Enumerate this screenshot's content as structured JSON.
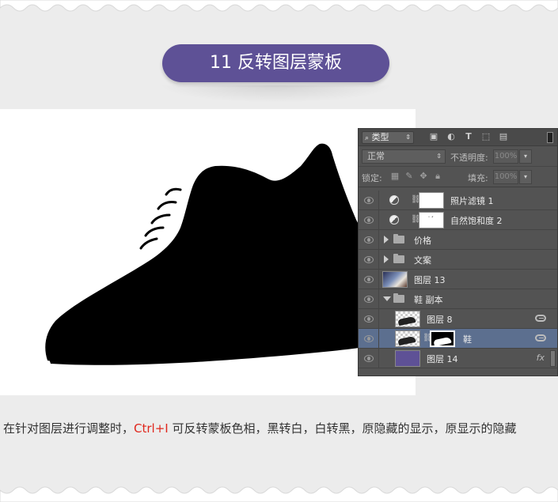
{
  "title": "11 反转图层蒙板",
  "panel": {
    "filter_label": "类型",
    "blend_mode": "正常",
    "opacity_label": "不透明度:",
    "opacity_value": "100%",
    "lock_label": "锁定:",
    "fill_label": "填充:",
    "fill_value": "100%",
    "layers": [
      {
        "name": "照片滤镜 1",
        "kind": "adjustment"
      },
      {
        "name": "自然饱和度 2",
        "kind": "adjustment"
      },
      {
        "name": "价格",
        "kind": "group-collapsed"
      },
      {
        "name": "文案",
        "kind": "group-collapsed"
      },
      {
        "name": "图层 13",
        "kind": "image"
      },
      {
        "name": "鞋 副本",
        "kind": "group-expanded"
      },
      {
        "name": "图层 8",
        "kind": "image-linked"
      },
      {
        "name": "鞋",
        "kind": "image-masked",
        "selected": true
      },
      {
        "name": "图层 14",
        "kind": "fill-fx"
      }
    ],
    "fx_label": "fx"
  },
  "description": {
    "before": "在针对图层进行调整时，",
    "highlight": "Ctrl+I",
    "after": " 可反转蒙板色相，黑转白，白转黑，原隐藏的显示，原显示的隐藏"
  },
  "colors": {
    "accent": "#5e5196",
    "highlight": "#e0261c",
    "background": "#ececec"
  }
}
